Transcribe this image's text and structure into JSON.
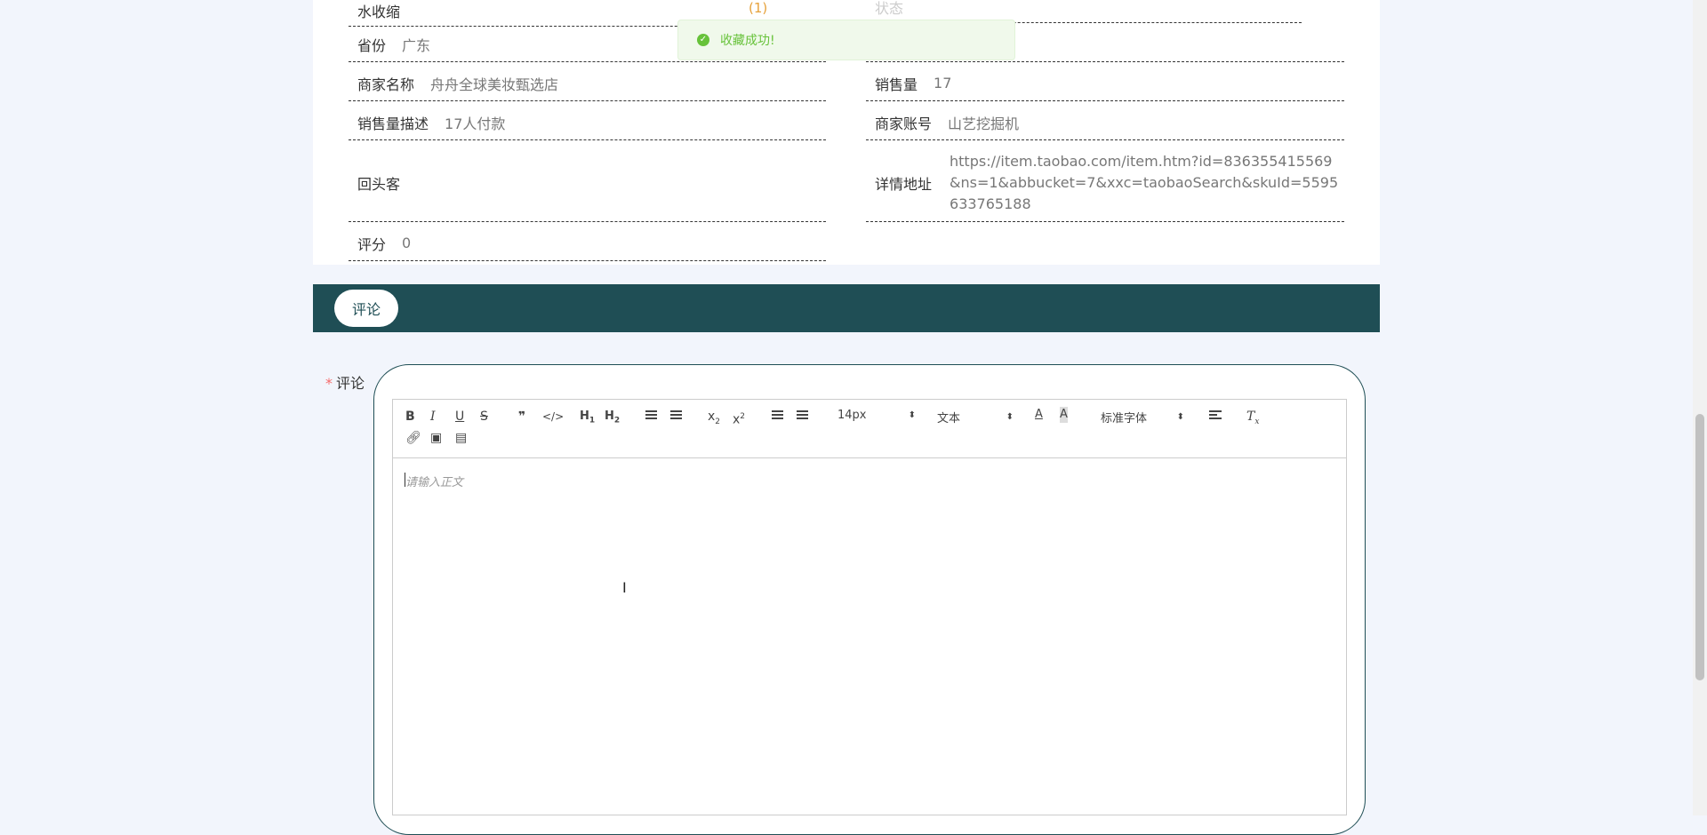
{
  "details": {
    "top_partial_label": "水收缩",
    "top_partial_count": "(1)",
    "top_partial_right": "状态",
    "province": {
      "label": "省份",
      "value": "广东"
    },
    "merchant_name": {
      "label": "商家名称",
      "value": "舟舟全球美妆甄选店"
    },
    "sales": {
      "label": "销售量",
      "value": "17"
    },
    "sales_desc": {
      "label": "销售量描述",
      "value": "17人付款"
    },
    "merchant_account": {
      "label": "商家账号",
      "value": "山艺挖掘机"
    },
    "repeat_customer": {
      "label": "回头客",
      "value": ""
    },
    "detail_url": {
      "label": "详情地址",
      "value": "https://item.taobao.com/item.htm?id=836355415569&ns=1&abbucket=7&xxc=taobaoSearch&skuId=5595633765188"
    },
    "rating": {
      "label": "评分",
      "value": "0"
    }
  },
  "toast": {
    "message": "收藏成功!",
    "icon": "check-circle-icon",
    "color": "#67c23a"
  },
  "tabs": [
    {
      "label": "评论"
    }
  ],
  "form": {
    "comment_label": "评论",
    "required_mark": "*",
    "editor": {
      "placeholder": "请输入正文",
      "font_size": "14px",
      "text_type": "文本",
      "font_family": "标准字体",
      "toolbar": [
        "bold",
        "italic",
        "underline",
        "strike",
        "blockquote",
        "code-block",
        "header-1",
        "header-2",
        "ordered-list",
        "bullet-list",
        "subscript",
        "superscript",
        "outdent",
        "indent",
        "size",
        "header",
        "color",
        "background",
        "font",
        "align",
        "clean",
        "link",
        "image",
        "video"
      ]
    }
  },
  "colors": {
    "accent": "#1f4e55",
    "background": "#f2f5fc",
    "required": "#f56c6c"
  }
}
